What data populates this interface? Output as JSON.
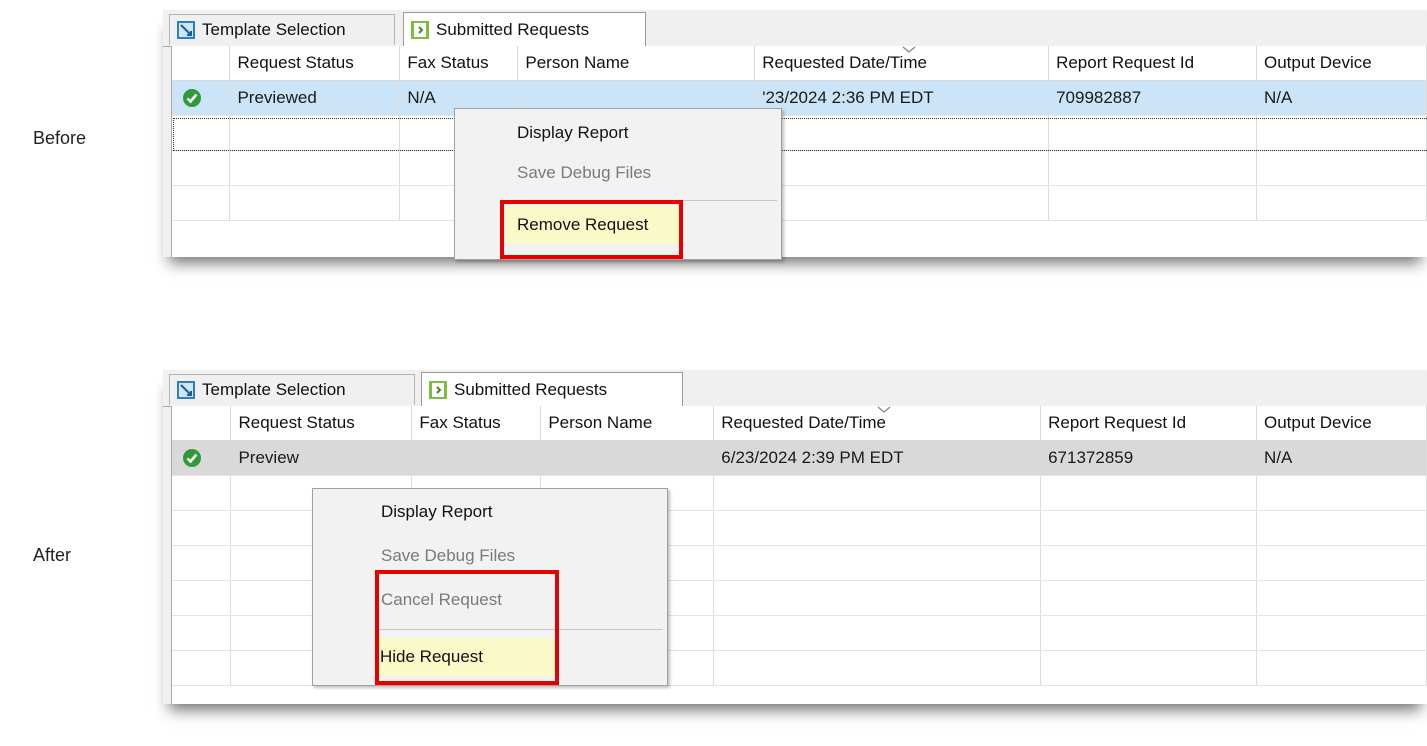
{
  "labels": {
    "before": "Before",
    "after": "After"
  },
  "tabs": [
    {
      "label": "Template Selection",
      "icon": "template-icon"
    },
    {
      "label": "Submitted Requests",
      "icon": "submitted-requests-icon"
    }
  ],
  "columns": [
    "Request Status",
    "Fax Status",
    "Person Name",
    "Requested Date/Time",
    "Report Request Id",
    "Output Device"
  ],
  "before": {
    "row": {
      "status": "Previewed",
      "fax": "N/A",
      "person": "",
      "datetime": "'23/2024 2:36 PM EDT",
      "request_id": "709982887",
      "output": "N/A"
    },
    "menu": {
      "display_report": "Display Report",
      "save_debug": "Save Debug Files",
      "remove_request": "Remove Request"
    }
  },
  "after": {
    "row": {
      "status": "Preview",
      "fax": "",
      "person": "",
      "datetime": "6/23/2024 2:39 PM EDT",
      "request_id": "671372859",
      "output": "N/A"
    },
    "menu": {
      "display_report": "Display Report",
      "save_debug": "Save Debug Files",
      "cancel_request": "Cancel Request",
      "hide_request": "Hide Request"
    }
  },
  "colors": {
    "highlight_box": "#e60000",
    "menu_hover": "#fafac8",
    "selected_row_blue": "#cce4f7",
    "selected_row_gray": "#d9d9d9",
    "status_ok": "#2e9b3a"
  }
}
